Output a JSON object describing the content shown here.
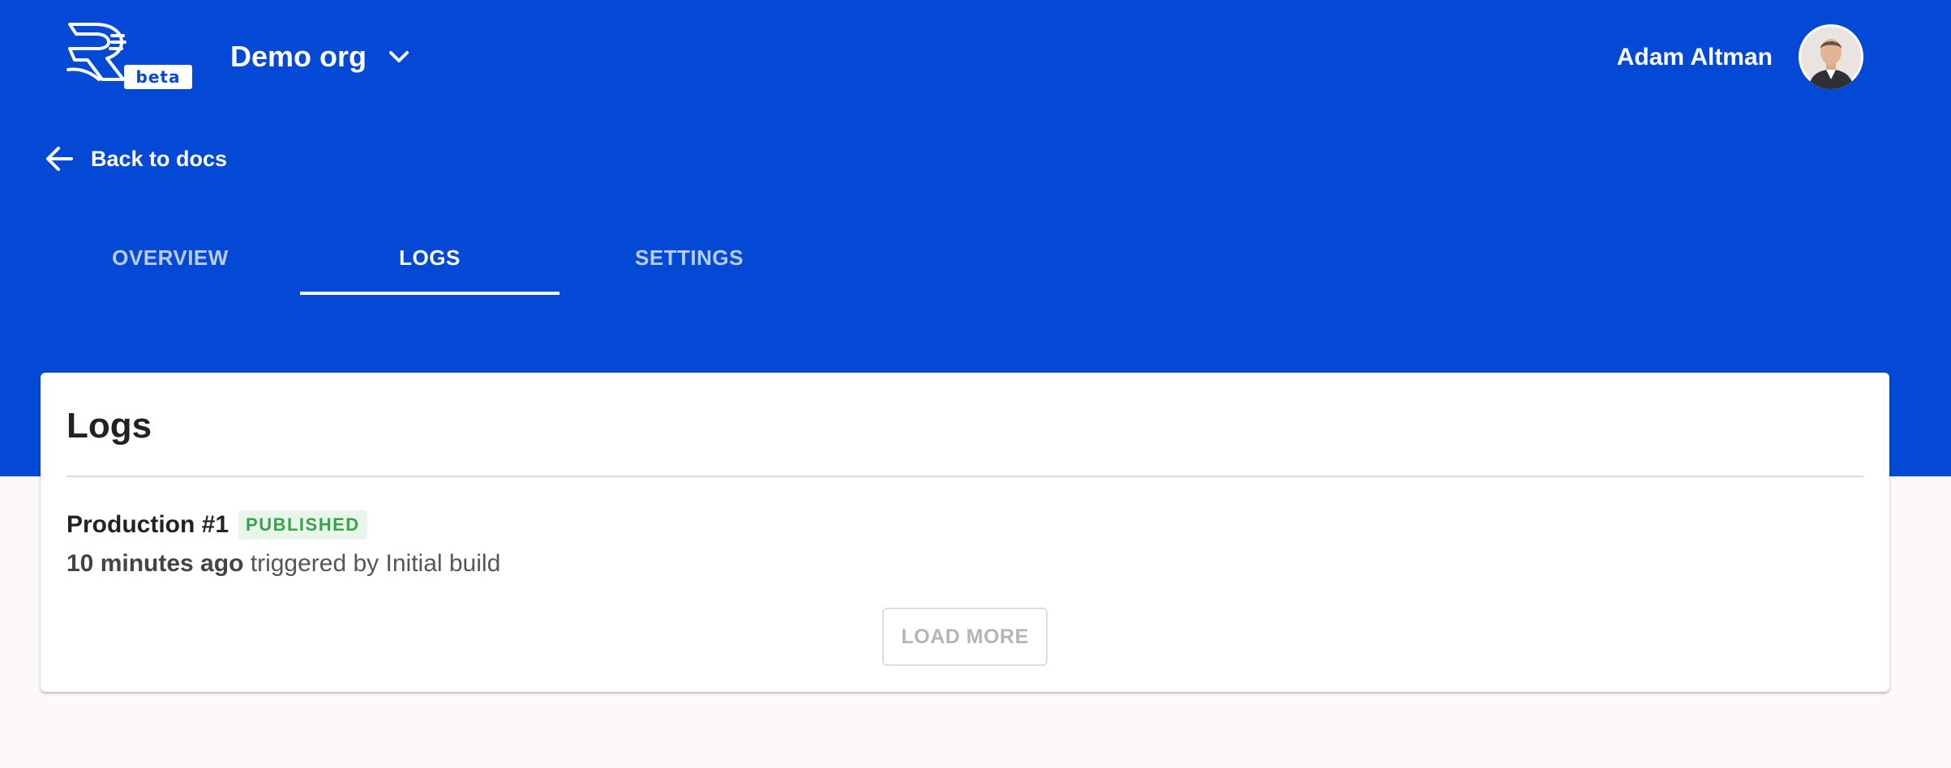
{
  "header": {
    "logo_badge": "beta",
    "org_name": "Demo org",
    "user_name": "Adam Altman"
  },
  "nav": {
    "back_label": "Back to docs"
  },
  "tabs": [
    {
      "label": "OVERVIEW",
      "active": false
    },
    {
      "label": "LOGS",
      "active": true
    },
    {
      "label": "SETTINGS",
      "active": false
    }
  ],
  "logs": {
    "title": "Logs",
    "entries": [
      {
        "name": "Production #1",
        "status": "PUBLISHED",
        "time": "10 minutes ago",
        "trigger": "triggered by Initial build"
      }
    ],
    "load_more_label": "LOAD MORE"
  },
  "colors": {
    "brand": "#0448d6",
    "published_text": "#3aa24a",
    "published_bg": "#e8f5e9",
    "page_bg": "#fcf9f8"
  },
  "icons": {
    "logo": "readme-logo-icon",
    "org_dropdown": "chevron-down-icon",
    "back": "arrow-left-icon"
  }
}
